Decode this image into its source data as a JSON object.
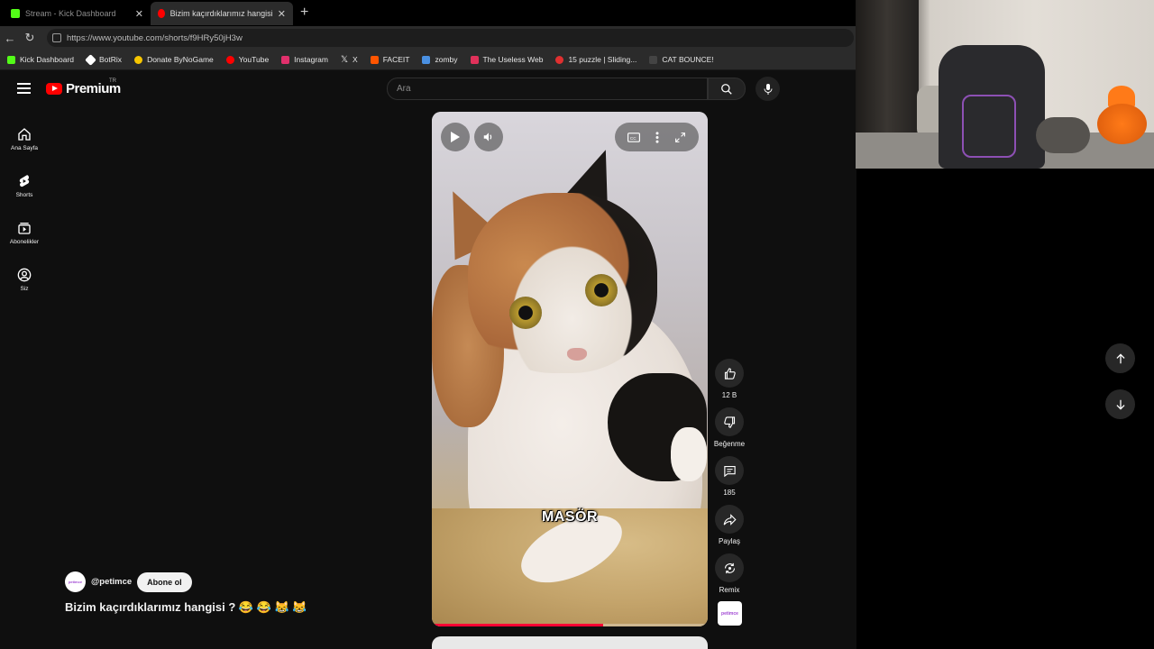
{
  "browser": {
    "tabs": [
      {
        "title": "Stream - Kick Dashboard",
        "active": false,
        "favicon_color": "#53fc18"
      },
      {
        "title": "Bizim kaçırdıklarımız hangisi ? 😂 😂",
        "active": true,
        "favicon_color": "#ff0000"
      }
    ],
    "url": "https://www.youtube.com/shorts/f9HRy50jH3w",
    "bookmarks": [
      {
        "label": "Kick Dashboard",
        "icon_color": "#53fc18"
      },
      {
        "label": "BotRix",
        "icon_color": "#ffffff"
      },
      {
        "label": "Donate ByNoGame",
        "icon_color": "#f7c600"
      },
      {
        "label": "YouTube",
        "icon_color": "#ff0000"
      },
      {
        "label": "Instagram",
        "icon_color": "#e1306c"
      },
      {
        "label": "X",
        "icon_color": "#ffffff"
      },
      {
        "label": "FACEIT",
        "icon_color": "#ff5500"
      },
      {
        "label": "zomby",
        "icon_color": "#4a90e2"
      },
      {
        "label": "The Useless Web",
        "icon_color": "#e0315a"
      },
      {
        "label": "15 puzzle | Sliding...",
        "icon_color": "#e03030"
      },
      {
        "label": "CAT BOUNCE!",
        "icon_color": "#444444"
      }
    ]
  },
  "youtube": {
    "logo_text": "Premium",
    "country_code": "TR",
    "search_placeholder": "Ara",
    "guide": [
      {
        "label": "Ana Sayfa",
        "icon": "home-icon"
      },
      {
        "label": "Shorts",
        "icon": "shorts-icon"
      },
      {
        "label": "Abonelikler",
        "icon": "subscriptions-icon"
      },
      {
        "label": "Siz",
        "icon": "you-icon"
      }
    ],
    "short": {
      "caption": "MASÖR",
      "progress_fraction": 0.62,
      "channel_handle": "@petimce",
      "subscribe_label": "Abone ol",
      "title": "Bizim kaçırdıklarımız hangisi ? 😂 😂 😹 😹",
      "channel_logo_text": "petimce"
    },
    "actions": {
      "like_count": "12 B",
      "dislike_label": "Beğenme",
      "comment_count": "185",
      "share_label": "Paylaş",
      "remix_label": "Remix"
    }
  },
  "colors": {
    "youtube_red": "#ff0000",
    "progress_red": "#ff0033",
    "page_bg": "#0f0f0f"
  }
}
